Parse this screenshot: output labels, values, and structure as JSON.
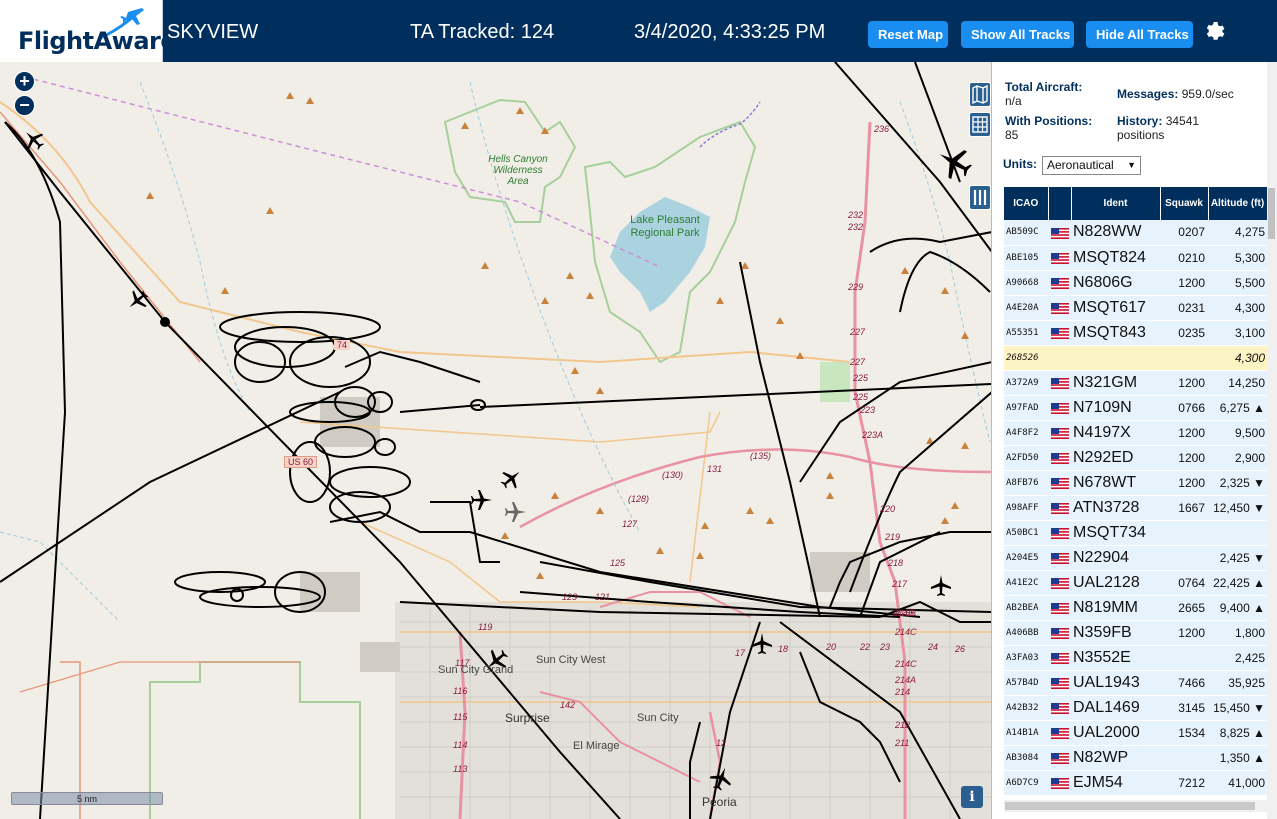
{
  "header": {
    "logo_text": "FlightAware",
    "app_name": "SKYVIEW",
    "tracked": "TA Tracked: 124",
    "datetime": "3/4/2020, 4:33:25 PM",
    "buttons": {
      "reset": "Reset Map",
      "show_all": "Show All Tracks",
      "hide_all": "Hide All Tracks"
    },
    "icons": {
      "gear": "gear-icon",
      "logo": "airplane-logo-icon"
    }
  },
  "map": {
    "zoom_in": "+",
    "zoom_out": "−",
    "scale": "5 nm",
    "info": "i",
    "labels": {
      "hells_canyon": "Hells Canyon Wilderness Area",
      "lake_pleasant": "Lake Pleasant Regional Park",
      "sun_city_grand": "Sun City Grand",
      "sun_city_west": "Sun City West",
      "surprise": "Surprise",
      "sun_city": "Sun City",
      "el_mirage": "El Mirage",
      "peoria": "Peoria",
      "us60": "US 60",
      "r74": "74",
      "r236": "236",
      "r232": "232",
      "r229": "229",
      "r227": "227",
      "r225": "225",
      "r223": "223",
      "r223a": "223A",
      "r131": "131",
      "r135": "(135)",
      "r130": "(130)",
      "r128": "(128)",
      "r127": "127",
      "r125": "125",
      "r123": "123",
      "r121": "121",
      "r119": "119",
      "r117": "117",
      "r116": "116",
      "r115": "115",
      "r114": "114",
      "r113": "113",
      "r142": "142",
      "r12": "12",
      "r17": "17",
      "r18": "18",
      "r20": "20",
      "r22": "22",
      "r23": "23",
      "r24": "24",
      "r26": "26",
      "r214c": "214C",
      "r214b": "214B",
      "r214a": "214A",
      "r214": "214",
      "r215b": "215B",
      "r217": "217",
      "r218": "218",
      "r219": "219",
      "r220": "220",
      "r211": "211",
      "r212": "212"
    },
    "icons": {
      "zoom_in": "plus-icon",
      "zoom_out": "minus-icon",
      "map_layer": "map-icon",
      "grid": "grid-icon",
      "columns": "columns-icon",
      "aircraft": "airplane-icon"
    }
  },
  "sidebar": {
    "total_aircraft_label": "Total Aircraft:",
    "total_aircraft_value": "n/a",
    "with_positions_label": "With Positions:",
    "with_positions_value": "85",
    "messages_label": "Messages:",
    "messages_value": "959.0/sec",
    "history_label": "History:",
    "history_value": "34541",
    "history_unit": "positions",
    "units_label": "Units:",
    "units_value": "Aeronautical",
    "columns": [
      "ICAO",
      "",
      "Ident",
      "Squawk",
      "Altitude (ft)"
    ],
    "rows": [
      {
        "icao": "AB509C",
        "ident": "N828WW",
        "squawk": "0207",
        "alt": "4,275"
      },
      {
        "icao": "ABE105",
        "ident": "MSQT824",
        "squawk": "0210",
        "alt": "5,300"
      },
      {
        "icao": "A90668",
        "ident": "N6806G",
        "squawk": "1200",
        "alt": "5,500"
      },
      {
        "icao": "A4E20A",
        "ident": "MSQT617",
        "squawk": "0231",
        "alt": "4,300"
      },
      {
        "icao": "A55351",
        "ident": "MSQT843",
        "squawk": "0235",
        "alt": "3,100"
      },
      {
        "icao": "268526",
        "ident": "",
        "squawk": "",
        "alt": "4,300",
        "selected": true,
        "noflag": true
      },
      {
        "icao": "A372A9",
        "ident": "N321GM",
        "squawk": "1200",
        "alt": "14,250"
      },
      {
        "icao": "A97FAD",
        "ident": "N7109N",
        "squawk": "0766",
        "alt": "6,275 ▲"
      },
      {
        "icao": "A4F8F2",
        "ident": "N4197X",
        "squawk": "1200",
        "alt": "9,500"
      },
      {
        "icao": "A2FD50",
        "ident": "N292ED",
        "squawk": "1200",
        "alt": "2,900"
      },
      {
        "icao": "A8FB76",
        "ident": "N678WT",
        "squawk": "1200",
        "alt": "2,325 ▼"
      },
      {
        "icao": "A98AFF",
        "ident": "ATN3728",
        "squawk": "1667",
        "alt": "12,450 ▼"
      },
      {
        "icao": "A50BC1",
        "ident": "MSQT734",
        "squawk": "",
        "alt": ""
      },
      {
        "icao": "A204E5",
        "ident": "N22904",
        "squawk": "",
        "alt": "2,425 ▼"
      },
      {
        "icao": "A41E2C",
        "ident": "UAL2128",
        "squawk": "0764",
        "alt": "22,425 ▲"
      },
      {
        "icao": "AB2BEA",
        "ident": "N819MM",
        "squawk": "2665",
        "alt": "9,400 ▲"
      },
      {
        "icao": "A406BB",
        "ident": "N359FB",
        "squawk": "1200",
        "alt": "1,800"
      },
      {
        "icao": "A3FA03",
        "ident": "N3552E",
        "squawk": "",
        "alt": "2,425"
      },
      {
        "icao": "A57B4D",
        "ident": "UAL1943",
        "squawk": "7466",
        "alt": "35,925"
      },
      {
        "icao": "A42B32",
        "ident": "DAL1469",
        "squawk": "3145",
        "alt": "15,450 ▼"
      },
      {
        "icao": "A14B1A",
        "ident": "UAL2000",
        "squawk": "1534",
        "alt": "8,825 ▲"
      },
      {
        "icao": "AB3084",
        "ident": "N82WP",
        "squawk": "",
        "alt": "1,350 ▲"
      },
      {
        "icao": "A6D7C9",
        "ident": "EJM54",
        "squawk": "7212",
        "alt": "41,000"
      }
    ]
  },
  "colors": {
    "header_bg": "#002f5d",
    "button_bg": "#1a8ef0",
    "row_bg": "#e6f3fd",
    "selected_row_bg": "#fdf4c5"
  }
}
